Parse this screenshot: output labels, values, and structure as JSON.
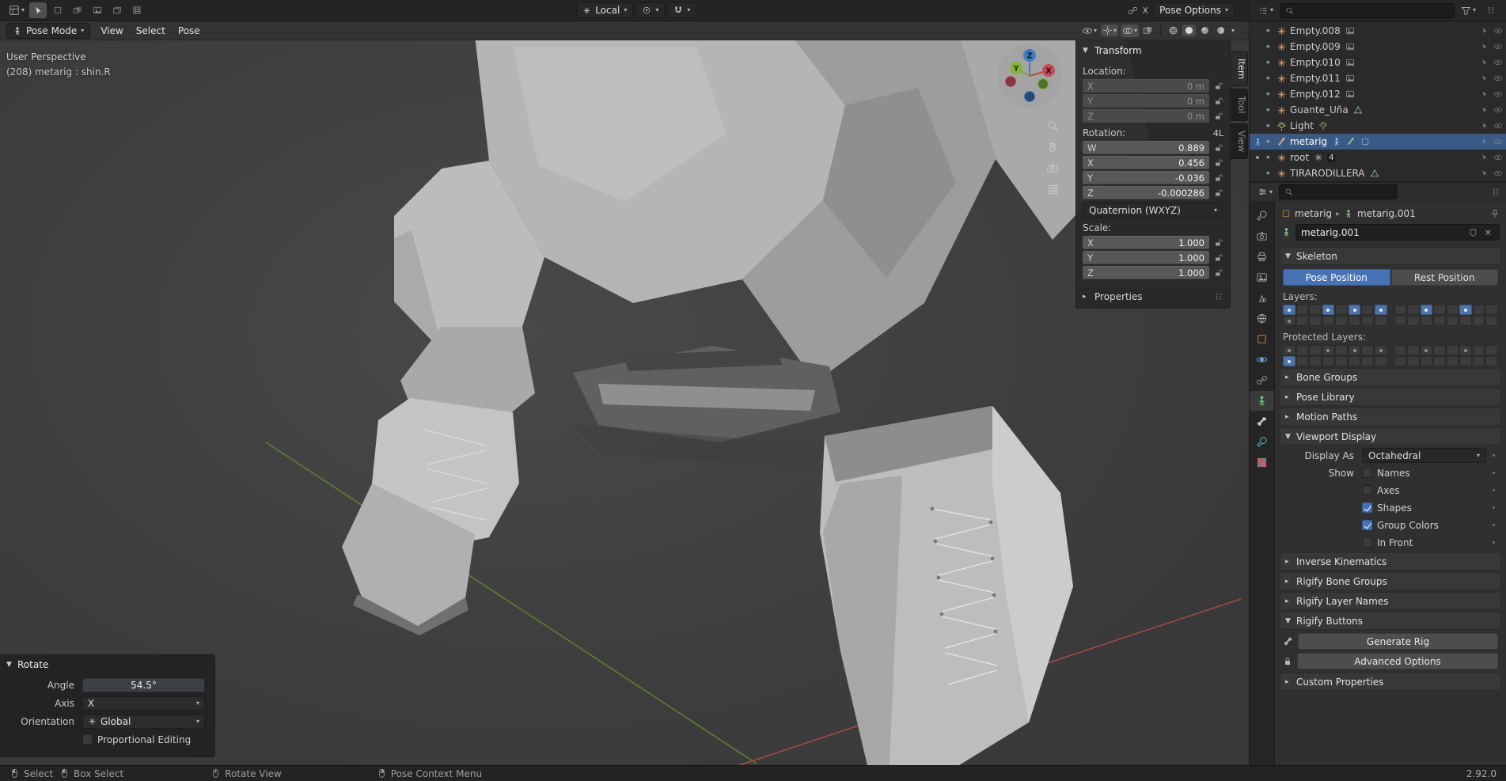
{
  "topbar": {
    "transform_orientation": "Local",
    "pose_options_label": "Pose Options",
    "close_label": "X",
    "outliner_search_placeholder": ""
  },
  "viewport_header": {
    "mode": "Pose Mode",
    "menus": [
      {
        "label": "View"
      },
      {
        "label": "Select"
      },
      {
        "label": "Pose"
      }
    ]
  },
  "viewport": {
    "view_label": "User Perspective",
    "selection_label": "(208) metarig : shin.R",
    "gizmo_axes": {
      "x": "X",
      "y": "Y",
      "z": "Z"
    }
  },
  "transform": {
    "title": "Transform",
    "location": {
      "label": "Location:",
      "rows": [
        [
          "X",
          "0 m"
        ],
        [
          "Y",
          "0 m"
        ],
        [
          "Z",
          "0 m"
        ]
      ]
    },
    "rotation": {
      "label": "Rotation:",
      "badge": "4L",
      "rows": [
        [
          "W",
          "0.889"
        ],
        [
          "X",
          "0.456"
        ],
        [
          "Y",
          "-0.036"
        ],
        [
          "Z",
          "-0.000286"
        ]
      ]
    },
    "rotation_mode": "Quaternion (WXYZ)",
    "scale": {
      "label": "Scale:",
      "rows": [
        [
          "X",
          "1.000"
        ],
        [
          "Y",
          "1.000"
        ],
        [
          "Z",
          "1.000"
        ]
      ]
    },
    "properties_label": "Properties",
    "tabs": [
      {
        "label": "Item",
        "active": true
      },
      {
        "label": "Tool",
        "active": false
      },
      {
        "label": "View",
        "active": false
      }
    ]
  },
  "outliner": {
    "items": [
      {
        "label": "Empty.008",
        "icon": "empty",
        "extra_icons": [
          "image"
        ]
      },
      {
        "label": "Empty.009",
        "icon": "empty",
        "extra_icons": [
          "image"
        ]
      },
      {
        "label": "Empty.010",
        "icon": "empty",
        "extra_icons": [
          "image"
        ]
      },
      {
        "label": "Empty.011",
        "icon": "empty",
        "extra_icons": [
          "image"
        ]
      },
      {
        "label": "Empty.012",
        "icon": "empty",
        "extra_icons": [
          "image"
        ]
      },
      {
        "label": "Guante_Uña",
        "icon": "empty",
        "extra_icons": [
          "mesh-data"
        ]
      },
      {
        "label": "Light",
        "icon": "light",
        "extra_icons": [
          "light-data"
        ]
      },
      {
        "label": "metarig",
        "icon": "armature",
        "selected": true,
        "gutter": "pose",
        "extra_icons": [
          "pose-figure",
          "armature-data",
          "shape"
        ]
      },
      {
        "label": "root",
        "icon": "empty",
        "gutter": "dot",
        "extra_icons": [
          "empty-data"
        ],
        "count": "4"
      },
      {
        "label": "TIRARODILLERA",
        "icon": "empty",
        "extra_icons": [
          "mesh-data"
        ]
      }
    ]
  },
  "properties": {
    "breadcrumb": {
      "object": "metarig",
      "data": "metarig.001"
    },
    "name_field": "metarig.001",
    "skeleton": {
      "title": "Skeleton",
      "pose_position": "Pose Position",
      "rest_position": "Rest Position",
      "layers_label": "Layers:",
      "layers": {
        "active": [
          0,
          3,
          5,
          7,
          10,
          13
        ],
        "dots": [
          0,
          3,
          5,
          7,
          10,
          13,
          16
        ]
      },
      "protected_label": "Protected Layers:",
      "protected": {
        "active": [
          16
        ],
        "dots": [
          0,
          3,
          5,
          7,
          10,
          13,
          16
        ]
      }
    },
    "collapsed_before": [
      "Bone Groups",
      "Pose Library",
      "Motion Paths"
    ],
    "viewport_display": {
      "title": "Viewport Display",
      "display_as_label": "Display As",
      "display_as_value": "Octahedral",
      "show_label": "Show",
      "options": [
        {
          "label": "Names",
          "checked": false
        },
        {
          "label": "Axes",
          "checked": false
        },
        {
          "label": "Shapes",
          "checked": true
        },
        {
          "label": "Group Colors",
          "checked": true
        },
        {
          "label": "In Front",
          "checked": false
        }
      ]
    },
    "collapsed_after": [
      "Inverse Kinematics",
      "Rigify Bone Groups",
      "Rigify Layer Names"
    ],
    "rigify_buttons": {
      "title": "Rigify Buttons",
      "generate": "Generate Rig",
      "advanced": "Advanced Options"
    },
    "custom_properties": "Custom Properties",
    "tabs": [
      {
        "name": "tool"
      },
      {
        "name": "render"
      },
      {
        "name": "output"
      },
      {
        "name": "view-layer"
      },
      {
        "name": "scene"
      },
      {
        "name": "world"
      },
      {
        "name": "object"
      },
      {
        "name": "physics"
      },
      {
        "name": "object-constraints"
      },
      {
        "name": "object-data",
        "active": true
      },
      {
        "name": "bone"
      },
      {
        "name": "bone-constraint"
      },
      {
        "name": "material"
      }
    ]
  },
  "operator_panel": {
    "title": "Rotate",
    "angle_label": "Angle",
    "angle_value": "54.5°",
    "axis_label": "Axis",
    "axis_value": "X",
    "orientation_label": "Orientation",
    "orientation_value": "Global",
    "proportional_editing": "Proportional Editing"
  },
  "statusbar": {
    "keymap": [
      {
        "label": "Select",
        "mouse": "left"
      },
      {
        "label": "Box Select",
        "mouse": "left"
      },
      {
        "label": "Rotate View",
        "mouse": "middle"
      },
      {
        "label": "Pose Context Menu",
        "mouse": "right"
      }
    ],
    "version": "2.92.0"
  }
}
